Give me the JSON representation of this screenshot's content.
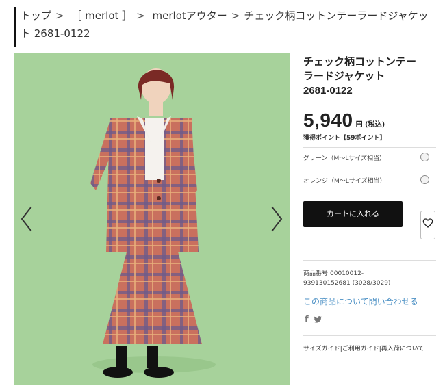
{
  "breadcrumb": {
    "top": "トップ",
    "sep": ">",
    "brand": "［ merlot ］",
    "category": "merlotアウター",
    "current_line1": "チェック柄コットンテーラードジャケッ",
    "current_line2": "ト 2681-0122"
  },
  "product": {
    "title_line1": "チェック柄コットンテー",
    "title_line2": "ラードジャケット",
    "title_line3": "2681-0122",
    "price": "5,940",
    "price_unit": "円 (税込)",
    "points": "獲得ポイント【59ポイント】",
    "options": [
      {
        "label": "グリーン（M〜Lサイズ相当）"
      },
      {
        "label": "オレンジ（M〜Lサイズ相当）"
      }
    ],
    "cart_label": "カートに入れる",
    "sku_line1": "商品番号:00010012-",
    "sku_line2": "939130152681 (3028/3029)",
    "contact": "この商品について問い合わせる",
    "footer_links": "サイズガイド|ご利用ガイド|再入荷について"
  },
  "colors": {
    "background_green": "#a7d29b",
    "plaid_base": "#c9705e",
    "link_blue": "#4a8fc4"
  },
  "icons": {
    "prev": "chevron-left-icon",
    "next": "chevron-right-icon",
    "favorite": "heart-icon",
    "facebook": "facebook-icon",
    "twitter": "twitter-icon"
  }
}
